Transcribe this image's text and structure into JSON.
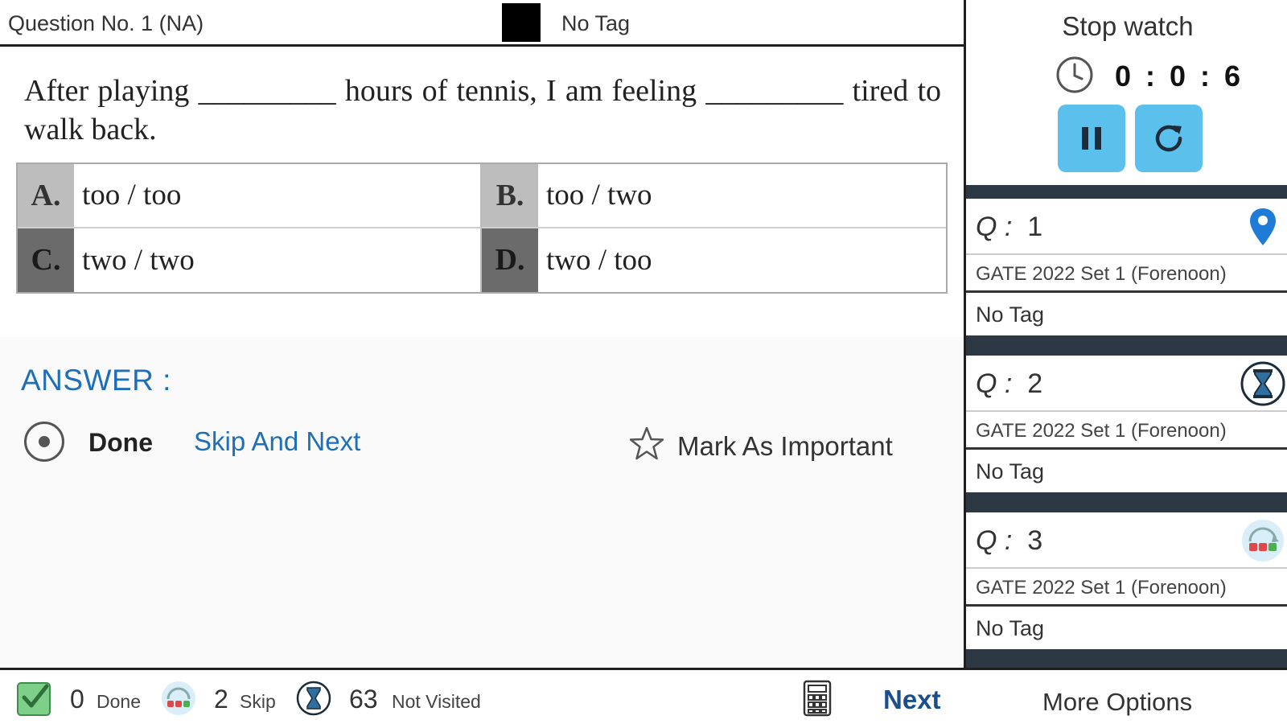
{
  "header": {
    "question_no": "Question No. 1 (NA)",
    "tag": "No Tag",
    "tag_color": "#000000"
  },
  "question": {
    "text": "After playing _________ hours of tennis, I am feeling _________ tired to walk back.",
    "options": [
      {
        "letter": "A.",
        "text": "too / too"
      },
      {
        "letter": "B.",
        "text": "too / two"
      },
      {
        "letter": "C.",
        "text": "two / two"
      },
      {
        "letter": "D.",
        "text": "two / too"
      }
    ]
  },
  "answer": {
    "label": "ANSWER :",
    "done_label": "Done",
    "skip_label": "Skip And Next",
    "mark_label": "Mark As Important"
  },
  "stopwatch": {
    "title": "Stop watch",
    "time": "0 : 0 : 6"
  },
  "question_list": [
    {
      "prefix": "Q :",
      "number": "1",
      "source": "GATE 2022 Set 1 (Forenoon)",
      "tag": "No Tag",
      "icon": "location-pin-icon"
    },
    {
      "prefix": "Q :",
      "number": "2",
      "source": "GATE 2022 Set 1 (Forenoon)",
      "tag": "No Tag",
      "icon": "hourglass-icon"
    },
    {
      "prefix": "Q :",
      "number": "3",
      "source": "GATE 2022 Set 1 (Forenoon)",
      "tag": "No Tag",
      "icon": "skip-icon"
    }
  ],
  "footer": {
    "done_count": "0",
    "done_label": "Done",
    "skip_count": "2",
    "skip_label": "Skip",
    "not_visited_count": "63",
    "not_visited_label": "Not Visited",
    "next_label": "Next",
    "more_label": "More Options"
  },
  "colors": {
    "accent_blue": "#1e6fb8",
    "button_blue": "#5bc0eb",
    "divider_dark": "#2c3945"
  }
}
